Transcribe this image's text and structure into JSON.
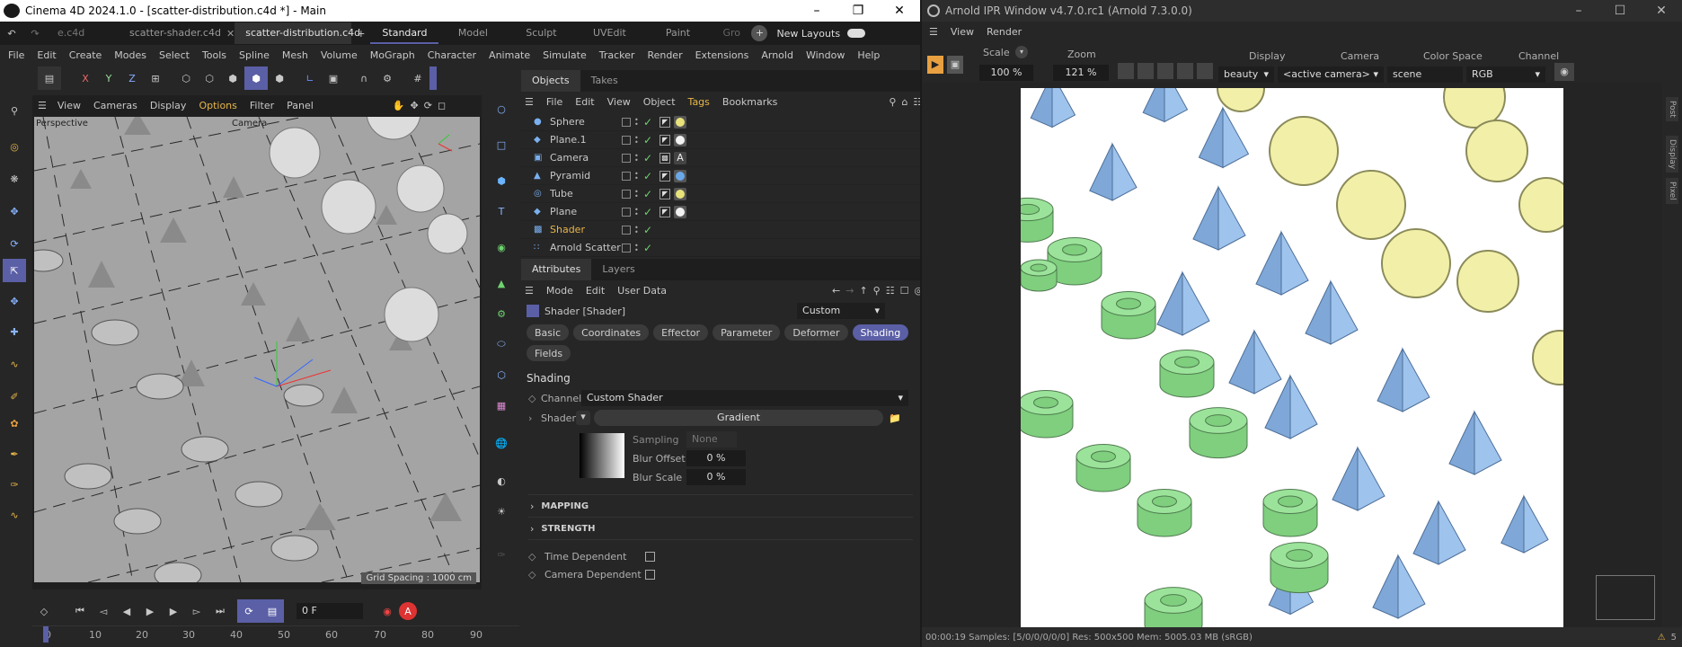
{
  "c4d": {
    "title": "Cinema 4D 2024.1.0 - [scatter-distribution.c4d *] - Main",
    "doc_tabs": [
      "e.c4d",
      "scatter-shader.c4d",
      "scatter-distribution.c4d"
    ],
    "layouts": [
      "Standard",
      "Model",
      "Sculpt",
      "UVEdit",
      "Paint",
      "Gro"
    ],
    "new_layouts": "New Layouts",
    "menu": [
      "File",
      "Edit",
      "Create",
      "Modes",
      "Select",
      "Tools",
      "Spline",
      "Mesh",
      "Volume",
      "MoGraph",
      "Character",
      "Animate",
      "Simulate",
      "Tracker",
      "Render",
      "Extensions",
      "Arnold",
      "Window",
      "Help"
    ],
    "viewport_menu": [
      "View",
      "Cameras",
      "Display",
      "Options",
      "Filter",
      "Panel"
    ],
    "viewport_label": "Perspective",
    "viewport_camera": "Camera",
    "grid_spacing": "Grid Spacing : 1000 cm",
    "obj_tabs": [
      "Objects",
      "Takes"
    ],
    "obj_menu": [
      "File",
      "Edit",
      "View",
      "Object",
      "Tags",
      "Bookmarks"
    ],
    "objects": [
      {
        "name": "Sphere",
        "icon": "sphere-icon",
        "tag": "yellow"
      },
      {
        "name": "Plane.1",
        "icon": "plane-icon",
        "tag": "white"
      },
      {
        "name": "Camera",
        "icon": "camera-icon",
        "tag": "A"
      },
      {
        "name": "Pyramid",
        "icon": "pyramid-icon",
        "tag": "blue"
      },
      {
        "name": "Tube",
        "icon": "tube-icon",
        "tag": "yellow"
      },
      {
        "name": "Plane",
        "icon": "plane-icon",
        "tag": "white"
      },
      {
        "name": "Shader",
        "icon": "shader-icon",
        "tag": ""
      },
      {
        "name": "Arnold Scatter",
        "icon": "scatter-icon",
        "tag": ""
      }
    ],
    "attr_tabs": [
      "Attributes",
      "Layers"
    ],
    "attr_menu": [
      "Mode",
      "Edit",
      "User Data"
    ],
    "attr_header": "Shader [Shader]",
    "attr_preset": "Custom",
    "attr_subtabs": [
      "Basic",
      "Coordinates",
      "Effector",
      "Parameter",
      "Deformer",
      "Shading",
      "Fields"
    ],
    "shading_title": "Shading",
    "channel_label": "Channel",
    "channel_value": "Custom Shader",
    "shader_label": "Shader",
    "shader_value": "Gradient",
    "sampling_label": "Sampling",
    "sampling_value": "None",
    "blur_offset_label": "Blur Offset",
    "blur_offset_value": "0 %",
    "blur_scale_label": "Blur Scale",
    "blur_scale_value": "0 %",
    "mapping": "MAPPING",
    "strength": "STRENGTH",
    "time_dependent": "Time Dependent",
    "camera_dependent": "Camera Dependent",
    "frame": "0 F",
    "timeline_ticks": [
      "0",
      "10",
      "20",
      "30",
      "40",
      "50",
      "60",
      "70",
      "80",
      "90"
    ]
  },
  "ipr": {
    "title": "Arnold IPR Window v4.7.0.rc1 (Arnold 7.3.0.0)",
    "menu": [
      "View",
      "Render"
    ],
    "scale_label": "Scale",
    "scale_value": "100 %",
    "zoom_label": "Zoom",
    "zoom_value": "121 %",
    "display_label": "Display",
    "display_value": "beauty",
    "camera_label": "Camera",
    "camera_value": "<active camera>",
    "colorspace_label": "Color Space",
    "colorspace_value": "scene (sRGB)",
    "channel_label": "Channel",
    "channel_value": "RGB",
    "side_tabs": [
      "Post",
      "Display",
      "Pixel"
    ],
    "status": "00:00:19  Samples: [5/0/0/0/0/0]  Res: 500x500  Mem: 5005.03 MB  (sRGB)",
    "warnings": "5",
    "colors": {
      "pyramid": "#9ec3ec",
      "sphere": "#f2f0a8",
      "tube": "#9be39a"
    }
  }
}
